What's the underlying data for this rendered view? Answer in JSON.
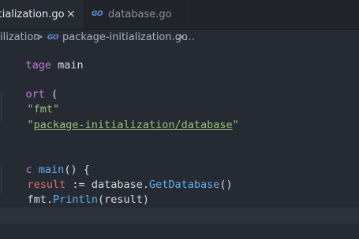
{
  "tabs": [
    {
      "label": "itialization.go",
      "active": true,
      "close_glyph": "×"
    },
    {
      "label": "database.go",
      "active": false,
      "icon": "go-file-icon"
    }
  ],
  "go_icon_text": "GO",
  "breadcrumb": {
    "folder": "ilization",
    "separator": ">",
    "file": "package-initialization.go",
    "more": "…"
  },
  "code": {
    "l1": {
      "kw": "tage",
      "rest": " main"
    },
    "l3": {
      "kw": "ort",
      "rest": " ("
    },
    "l4": {
      "str": "\"fmt\""
    },
    "l5": {
      "q1": "\"",
      "path": "package-initialization/database",
      "q2": "\""
    },
    "l8": {
      "kw": "c",
      "fn": "main",
      "rest": "() {"
    },
    "l9": {
      "var": "result",
      "op": " := ",
      "pkg": "database",
      "dot": ".",
      "fn": "GetDatabase",
      "paren": "()"
    },
    "l10": {
      "pkg": "fmt",
      "dot": ".",
      "fn": "Println",
      "open": "(",
      "arg": "result",
      "close": ")"
    }
  },
  "colors": {
    "keyword": "#c678dd",
    "string": "#98c379",
    "function": "#61afef",
    "variable": "#e06c75",
    "background": "#262a33"
  }
}
